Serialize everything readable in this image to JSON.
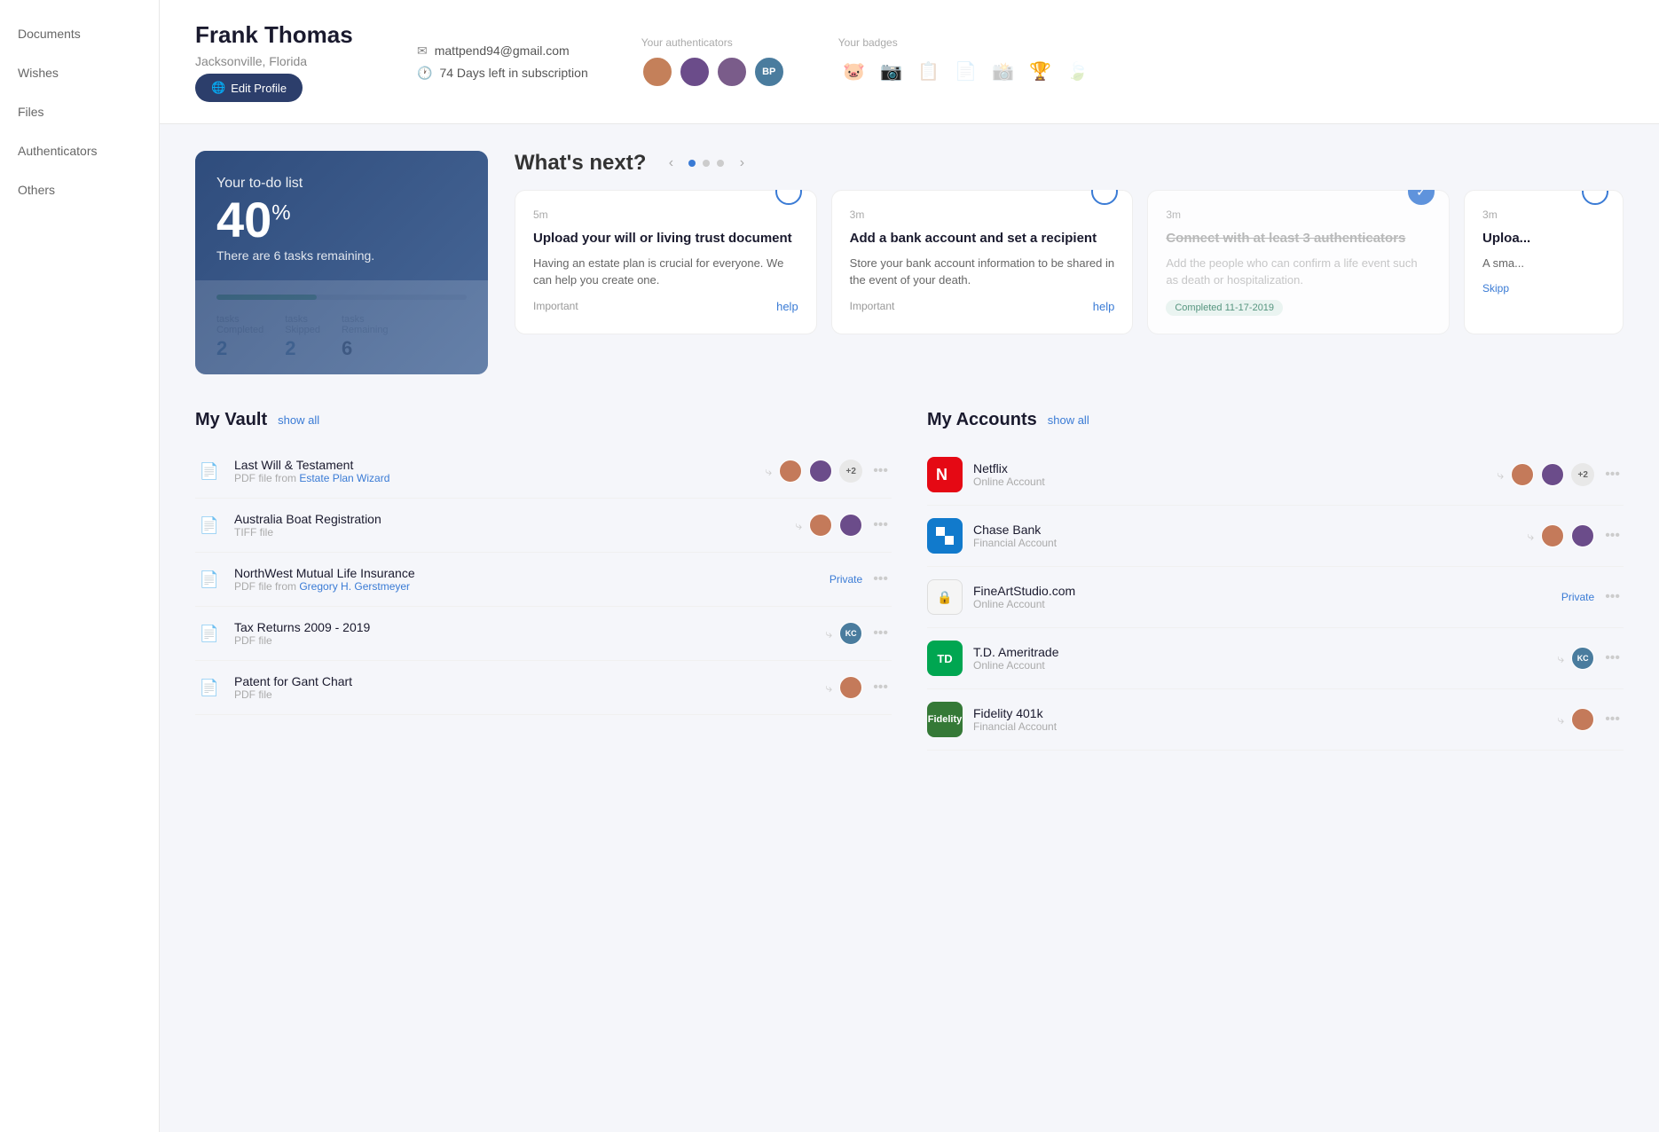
{
  "sidebar": {
    "items": [
      {
        "label": "Documents",
        "id": "documents"
      },
      {
        "label": "Wishes",
        "id": "wishes"
      },
      {
        "label": "Files",
        "id": "files"
      },
      {
        "label": "Authenticators",
        "id": "authenticators"
      },
      {
        "label": "Others",
        "id": "others"
      }
    ]
  },
  "profile": {
    "name": "Frank Thomas",
    "location": "Jacksonville, Florida",
    "email": "mattpend94@gmail.com",
    "subscription": "74 Days left in subscription",
    "edit_button": "Edit Profile"
  },
  "authenticators": {
    "label": "Your authenticators",
    "avatars": [
      {
        "initials": "",
        "color": "#c47a5a",
        "id": "auth1"
      },
      {
        "initials": "",
        "color": "#6b4c8a",
        "id": "auth2"
      },
      {
        "initials": "",
        "color": "#5c8a6b",
        "id": "auth3"
      },
      {
        "initials": "BP",
        "color": "#4a7c9e",
        "id": "auth4"
      }
    ]
  },
  "badges": {
    "label": "Your badges",
    "items": [
      {
        "emoji": "🐷",
        "active": true
      },
      {
        "emoji": "📷",
        "active": true
      },
      {
        "emoji": "📋",
        "active": false
      },
      {
        "emoji": "📄",
        "active": false
      },
      {
        "emoji": "📸",
        "active": false
      },
      {
        "emoji": "🏆",
        "active": true
      },
      {
        "emoji": "🍃",
        "active": false
      }
    ]
  },
  "todo": {
    "label": "Your to-do list",
    "percent": "40",
    "percent_symbol": "%",
    "remaining_text": "There are 6 tasks remaining.",
    "progress": 40,
    "stats": {
      "completed_label": "tasks\nCompleted",
      "completed_value": "2",
      "skipped_label": "tasks\nSkipped",
      "skipped_value": "2",
      "remaining_label": "tasks\nRemaining",
      "remaining_value": "6"
    }
  },
  "whats_next": {
    "title": "What's next?",
    "tasks": [
      {
        "id": "task1",
        "time": "5m",
        "title": "Upload your will or living trust document",
        "desc": "Having an estate plan is crucial for everyone. We can help you create one.",
        "importance": "Important",
        "action_label": "help",
        "status": "pending"
      },
      {
        "id": "task2",
        "time": "3m",
        "title": "Add a bank account and set a recipient",
        "desc": "Store your bank account information to be shared in the event of your death.",
        "importance": "Important",
        "action_label": "help",
        "status": "pending"
      },
      {
        "id": "task3",
        "time": "3m",
        "title": "Connect with at least 3 authenticators",
        "desc": "Add the people who can confirm a life event such as death or hospitalization.",
        "importance": "",
        "action_label": "",
        "status": "completed",
        "completed_date": "Completed 11-17-2019"
      },
      {
        "id": "task4",
        "time": "3m",
        "title": "Upload picture",
        "desc": "A small identifying...",
        "importance": "",
        "action_label": "Skipp",
        "status": "skipped"
      }
    ]
  },
  "vault": {
    "title": "My Vault",
    "show_all": "show all",
    "items": [
      {
        "id": "vault1",
        "name": "Last Will & Testament",
        "sub_prefix": "PDF file from ",
        "sub_link": "Estate Plan Wizard",
        "sub_link_url": "#",
        "has_share": true,
        "avatars": [
          "a1",
          "a2"
        ],
        "plus": "+2",
        "private": false
      },
      {
        "id": "vault2",
        "name": "Australia Boat Registration",
        "sub": "TIFF file",
        "has_share": true,
        "avatars": [
          "a1",
          "a2"
        ],
        "plus": null,
        "private": false
      },
      {
        "id": "vault3",
        "name": "NorthWest Mutual Life Insurance",
        "sub_prefix": "PDF file from ",
        "sub_link": "Gregory H. Gerstmeyer",
        "sub_link_url": "#",
        "has_share": false,
        "avatars": [],
        "plus": null,
        "private": true,
        "private_label": "Private"
      },
      {
        "id": "vault4",
        "name": "Tax Returns 2009 - 2019",
        "sub": "PDF file",
        "has_share": true,
        "avatars": [
          "kc"
        ],
        "plus": null,
        "private": false
      },
      {
        "id": "vault5",
        "name": "Patent for Gant Chart",
        "sub": "PDF file",
        "has_share": true,
        "avatars": [
          "a1"
        ],
        "plus": null,
        "private": false
      }
    ]
  },
  "accounts": {
    "title": "My Accounts",
    "show_all": "show all",
    "items": [
      {
        "id": "acc1",
        "name": "Netflix",
        "type": "Online Account",
        "logo_type": "netflix",
        "logo_text": "N",
        "has_share": true,
        "avatars": [
          "a1",
          "a2"
        ],
        "plus": "+2",
        "private": false
      },
      {
        "id": "acc2",
        "name": "Chase Bank",
        "type": "Financial Account",
        "logo_type": "chase",
        "logo_text": "C",
        "has_share": true,
        "avatars": [
          "a1",
          "a2"
        ],
        "plus": null,
        "private": false
      },
      {
        "id": "acc3",
        "name": "FineArtStudio.com",
        "type": "Online Account",
        "logo_type": "fineart",
        "logo_text": "🔒",
        "has_share": false,
        "avatars": [],
        "plus": null,
        "private": true,
        "private_label": "Private"
      },
      {
        "id": "acc4",
        "name": "T.D. Ameritrade",
        "type": "Online Account",
        "logo_type": "tdameritrade",
        "logo_text": "TD",
        "has_share": true,
        "avatars": [
          "kc"
        ],
        "plus": null,
        "private": false
      },
      {
        "id": "acc5",
        "name": "Fidelity 401k",
        "type": "Financial Account",
        "logo_type": "fidelity",
        "logo_text": "F",
        "has_share": true,
        "avatars": [
          "a1"
        ],
        "plus": null,
        "private": false
      }
    ]
  }
}
